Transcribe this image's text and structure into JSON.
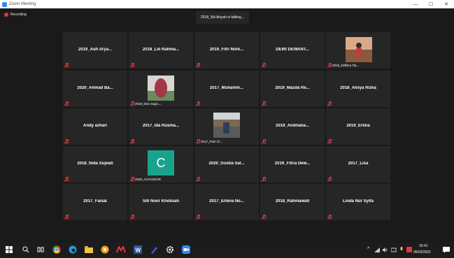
{
  "window": {
    "title": "Zoom Meeting",
    "minimize": "—",
    "maximize": "☐",
    "close": "✕"
  },
  "meeting": {
    "recording_label": "Recording",
    "talking_banner": "2018_Siti Aisyah is talking...",
    "tiles": [
      {
        "name": "2019_Aufi Arya..."
      },
      {
        "name": "2018_Lili Rahma..."
      },
      {
        "name": "2019_Fitri Nork..."
      },
      {
        "name": "DEWI DEWANT..."
      },
      {
        "label": "2018_Deffera Tal..."
      },
      {
        "name": "2020_Ahmad Ba..."
      },
      {
        "label": "2019_Dwi mugi L..."
      },
      {
        "name": "2017_Muhamm..."
      },
      {
        "name": "2019_Mazda Re..."
      },
      {
        "name": "2018_Alisya Rizka"
      },
      {
        "name": "Andy azhari"
      },
      {
        "name": "2017_Ida Rusma..."
      },
      {
        "label": "2017_Putri Cl..."
      },
      {
        "name": "2019_Andriana..."
      },
      {
        "name": "2019_Erlina"
      },
      {
        "name": "2018_Nida Supiati"
      },
      {
        "label": "2020_ALFANOOR",
        "letter": "C"
      },
      {
        "name": "2020_Gustia Sal..."
      },
      {
        "name": "2019_Fitria Dew..."
      },
      {
        "name": "2017_Lisa"
      },
      {
        "name": "2017_Faisal"
      },
      {
        "name": "Siti Noor Kholisah"
      },
      {
        "name": "2017_Erlena No..."
      },
      {
        "name": "2018_Rahmawati"
      },
      {
        "name": "Linda Nur Syifa"
      }
    ]
  },
  "taskbar": {
    "time": "16:41",
    "date": "05/02/2021",
    "chevron": "^",
    "icons": [
      "windows-start",
      "search",
      "task-view",
      "chrome",
      "edge",
      "file-explorer",
      "chromium",
      "app-red",
      "word",
      "pen",
      "settings",
      "zoom"
    ]
  },
  "colors": {
    "tile_bg": "#262626",
    "meeting_bg": "#1a1a1a",
    "mute_red": "#e0393e",
    "avatar_teal": "#1aa38c",
    "zoom_blue": "#2d8cff"
  }
}
